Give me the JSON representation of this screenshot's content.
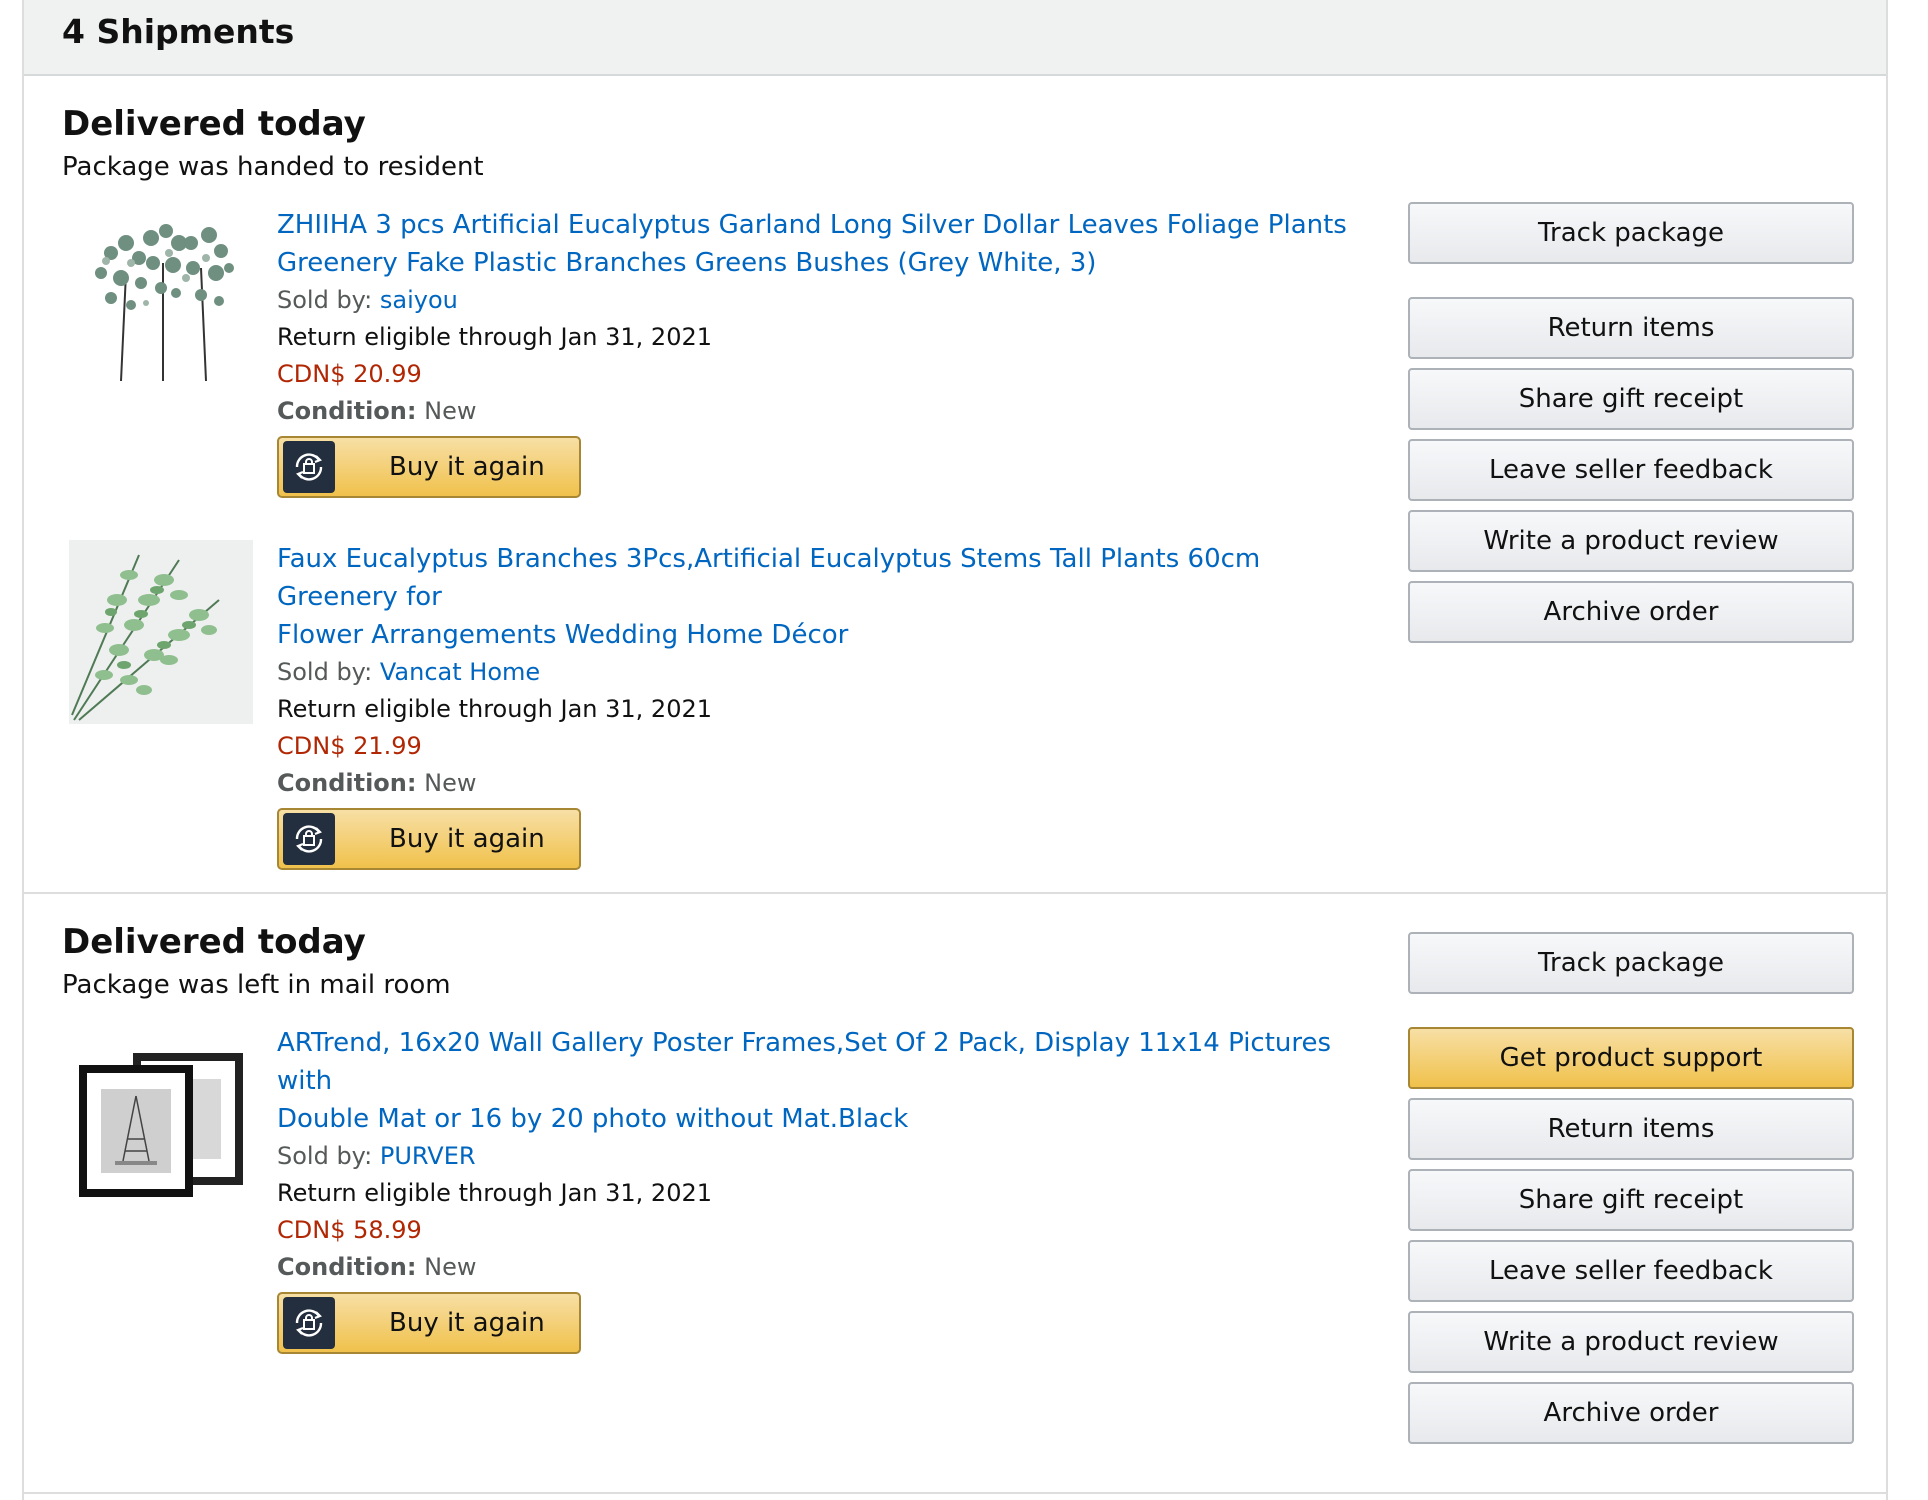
{
  "header": {
    "title": "4 Shipments"
  },
  "shipments": [
    {
      "status": "Delivered today",
      "substatus": "Package was handed to resident",
      "items": [
        {
          "title_line1": "ZHIIHA 3 pcs Artificial Eucalyptus Garland Long Silver Dollar Leaves Foliage Plants",
          "title_line2": "Greenery Fake Plastic Branches Greens Bushes (Grey White, 3)",
          "sold_by_label": "Sold by:",
          "seller": "saiyou",
          "return_text": "Return eligible through Jan 31, 2021",
          "price": "CDN$ 20.99",
          "condition_label": "Condition:",
          "condition": "New",
          "buy_label": "Buy it again"
        },
        {
          "title_line1": "Faux Eucalyptus Branches 3Pcs,Artificial Eucalyptus Stems Tall Plants 60cm Greenery for",
          "title_line2": "Flower Arrangements Wedding Home Décor",
          "sold_by_label": "Sold by:",
          "seller": "Vancat Home",
          "return_text": "Return eligible through Jan 31, 2021",
          "price": "CDN$ 21.99",
          "condition_label": "Condition:",
          "condition": "New",
          "buy_label": "Buy it again"
        }
      ],
      "actions": [
        "Track package",
        "Return items",
        "Share gift receipt",
        "Leave seller feedback",
        "Write a product review",
        "Archive order"
      ]
    },
    {
      "status": "Delivered today",
      "substatus": "Package was left in mail room",
      "items": [
        {
          "title_line1": "ARTrend, 16x20 Wall Gallery Poster Frames,Set Of 2 Pack, Display 11x14 Pictures with",
          "title_line2": "Double Mat or 16 by 20 photo without Mat.Black",
          "sold_by_label": "Sold by:",
          "seller": "PURVER",
          "return_text": "Return eligible through Jan 31, 2021",
          "price": "CDN$ 58.99",
          "condition_label": "Condition:",
          "condition": "New",
          "buy_label": "Buy it again"
        }
      ],
      "actions": [
        "Track package",
        "Get product support",
        "Return items",
        "Share gift receipt",
        "Leave seller feedback",
        "Write a product review",
        "Archive order"
      ]
    }
  ],
  "colors": {
    "link": "#0066c0",
    "price": "#b12704",
    "primary_button": "#f0c14b",
    "secondary_button": "#e7e9ec"
  },
  "icons": {
    "buy_again": "buy-again-icon",
    "product_1": "eucalyptus-garland-image",
    "product_2": "eucalyptus-stems-image",
    "product_3": "poster-frames-image"
  }
}
